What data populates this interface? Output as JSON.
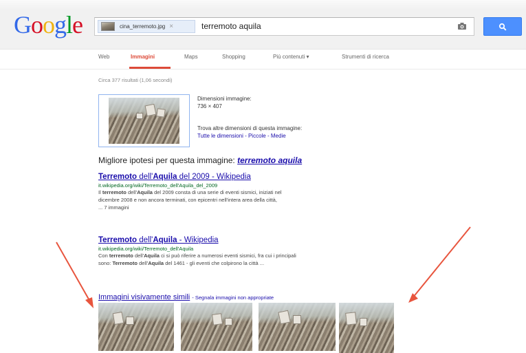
{
  "logo": {
    "text": "Google",
    "letters": [
      {
        "ch": "G",
        "color": "#3369e8"
      },
      {
        "ch": "o",
        "color": "#d50f25"
      },
      {
        "ch": "o",
        "color": "#eeb211"
      },
      {
        "ch": "g",
        "color": "#3369e8"
      },
      {
        "ch": "l",
        "color": "#009925"
      },
      {
        "ch": "e",
        "color": "#d50f25"
      }
    ]
  },
  "search": {
    "chip_filename": "cina_terremoto.jpg",
    "chip_remove": "×",
    "query": "terremoto aquila",
    "camera_icon": "camera-icon",
    "button_icon": "search-icon"
  },
  "tabs": [
    {
      "label": "Web",
      "active": false
    },
    {
      "label": "Immagini",
      "active": true
    },
    {
      "label": "Maps",
      "active": false
    },
    {
      "label": "Shopping",
      "active": false
    },
    {
      "label": "Più contenuti ▾",
      "active": false
    },
    {
      "label": "Strumenti di ricerca",
      "active": false
    }
  ],
  "stats": "Circa 377 risultati (1,06 secondi)",
  "image_info": {
    "dims_label": "Dimensioni immagine:",
    "dims_value": "736 × 407",
    "other_sizes_label": "Trova altre dimensioni di questa immagine:",
    "size_links": [
      "Tutte le dimensioni",
      "Piccole",
      "Medie"
    ],
    "separator": " - "
  },
  "best_guess": {
    "label": "Migliore ipotesi per questa immagine: ",
    "link": "terremoto aquila"
  },
  "results": [
    {
      "title": "Terremoto dell'Aquila del 2009 - Wikipedia",
      "url": "it.wikipedia.org/wiki/Terremoto_dell'Aquila_del_2009",
      "snippet_line1": "Il terremoto dell'Aquila del 2009 consta di una serie di eventi sismici, iniziati nel",
      "snippet_line2": "dicembre 2008 e non ancora terminati, con epicentri nell'intera area della città,",
      "more": "... 7 immagini"
    },
    {
      "title": "Terremoto dell'Aquila - Wikipedia",
      "url": "it.wikipedia.org/wiki/Terremoto_dell'Aquila",
      "snippet_line1": "Con terremoto dell'Aquila ci si può riferire a numerosi eventi sismici, fra cui i principali",
      "snippet_line2": "sono: Terremoto dell'Aquila del 1461 - gli eventi che colpirono la città ...",
      "more": ""
    }
  ],
  "similar": {
    "title": "Immagini visivamente simili",
    "report": "- Segnala immagini non appropriate",
    "count": 4
  },
  "colors": {
    "link": "#1a0dab",
    "url_green": "#006621",
    "active_tab": "#dd4b39",
    "search_button": "#4d90fe",
    "arrow": "#e8553e"
  }
}
